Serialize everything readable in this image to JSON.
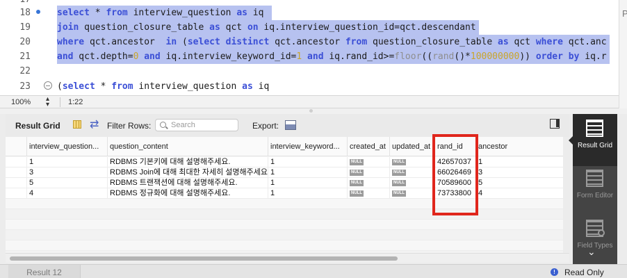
{
  "editor": {
    "line_numbers": [
      "17",
      "18",
      "19",
      "20",
      "21",
      "22",
      "23"
    ],
    "lines": [
      [
        {
          "t": "",
          "c": ""
        }
      ],
      [
        {
          "t": "select",
          "c": "kw"
        },
        {
          "t": " * ",
          "c": ""
        },
        {
          "t": "from",
          "c": "kw"
        },
        {
          "t": " interview_question ",
          "c": ""
        },
        {
          "t": "as",
          "c": "kw"
        },
        {
          "t": " iq ",
          "c": ""
        }
      ],
      [
        {
          "t": "join",
          "c": "kw"
        },
        {
          "t": " question_closure_table ",
          "c": ""
        },
        {
          "t": "as",
          "c": "kw"
        },
        {
          "t": " qct ",
          "c": ""
        },
        {
          "t": "on",
          "c": "kw"
        },
        {
          "t": " iq.interview_question_id=qct.descendant",
          "c": ""
        }
      ],
      [
        {
          "t": "where",
          "c": "kw"
        },
        {
          "t": " qct.ancestor  ",
          "c": ""
        },
        {
          "t": "in",
          "c": "kw"
        },
        {
          "t": " (",
          "c": ""
        },
        {
          "t": "select",
          "c": "kw"
        },
        {
          "t": " ",
          "c": ""
        },
        {
          "t": "distinct",
          "c": "kw"
        },
        {
          "t": " qct.ancestor ",
          "c": ""
        },
        {
          "t": "from",
          "c": "kw"
        },
        {
          "t": " question_closure_table ",
          "c": ""
        },
        {
          "t": "as",
          "c": "kw"
        },
        {
          "t": " qct ",
          "c": ""
        },
        {
          "t": "where",
          "c": "kw"
        },
        {
          "t": " qct.anc",
          "c": ""
        }
      ],
      [
        {
          "t": "and",
          "c": "kw"
        },
        {
          "t": " qct.depth=",
          "c": ""
        },
        {
          "t": "0",
          "c": "num"
        },
        {
          "t": " ",
          "c": ""
        },
        {
          "t": "and",
          "c": "kw"
        },
        {
          "t": " iq.interview_keyword_id=",
          "c": ""
        },
        {
          "t": "1",
          "c": "num"
        },
        {
          "t": " ",
          "c": ""
        },
        {
          "t": "and",
          "c": "kw"
        },
        {
          "t": " iq.rand_id>=",
          "c": ""
        },
        {
          "t": "floor",
          "c": "faded"
        },
        {
          "t": "((",
          "c": ""
        },
        {
          "t": "rand",
          "c": "faded"
        },
        {
          "t": "()*",
          "c": ""
        },
        {
          "t": "100000000",
          "c": "num"
        },
        {
          "t": ")) ",
          "c": ""
        },
        {
          "t": "order",
          "c": "kw"
        },
        {
          "t": " ",
          "c": ""
        },
        {
          "t": "by",
          "c": "kw"
        },
        {
          "t": " iq.r",
          "c": ""
        }
      ],
      [
        {
          "t": "",
          "c": ""
        }
      ],
      [
        {
          "t": "(",
          "c": ""
        },
        {
          "t": "select",
          "c": "kw"
        },
        {
          "t": " * ",
          "c": ""
        },
        {
          "t": "from",
          "c": "kw"
        },
        {
          "t": " interview_question ",
          "c": ""
        },
        {
          "t": "as",
          "c": "kw"
        },
        {
          "t": " iq",
          "c": ""
        }
      ]
    ],
    "selected_lines": [
      1,
      2,
      3,
      4
    ]
  },
  "status": {
    "zoom": "100%",
    "cursor_position": "1:22"
  },
  "toolbar": {
    "result_grid_label": "Result Grid",
    "filter_rows_label": "Filter Rows:",
    "search_placeholder": "Search",
    "export_label": "Export:"
  },
  "grid": {
    "columns": [
      "interview_question...",
      "question_content",
      "interview_keyword...",
      "created_at",
      "updated_at",
      "rand_id",
      "ancestor"
    ],
    "rows": [
      [
        "1",
        "RDBMS 기본키에 대해 설명해주세요.",
        "1",
        "NULL",
        "NULL",
        "42657037",
        "1"
      ],
      [
        "3",
        "RDBMS Join에 대해 최대한 자세히 설명해주세요.",
        "1",
        "NULL",
        "NULL",
        "66026469",
        "3"
      ],
      [
        "5",
        "RDBMS 트랜잭션에 대해 설명해주세요.",
        "1",
        "NULL",
        "NULL",
        "70589600",
        "5"
      ],
      [
        "4",
        "RDBMS 정규화에 대해 설명해주세요.",
        "1",
        "NULL",
        "NULL",
        "73733800",
        "4"
      ]
    ],
    "empty_rows": 7
  },
  "side_panel": {
    "items": [
      {
        "label": "Result Grid",
        "icon": "result-grid-icon",
        "active": true
      },
      {
        "label": "Form Editor",
        "icon": "form-editor-icon",
        "active": false
      },
      {
        "label": "Field Types",
        "icon": "field-types-icon",
        "active": false
      }
    ]
  },
  "bottom": {
    "tab_label": "Result 12",
    "read_only_label": "Read Only"
  },
  "colors": {
    "selection": "#b7c2f0",
    "keyword": "#3b4fd6",
    "number": "#c9a52a",
    "highlight_box": "#e0261c"
  }
}
